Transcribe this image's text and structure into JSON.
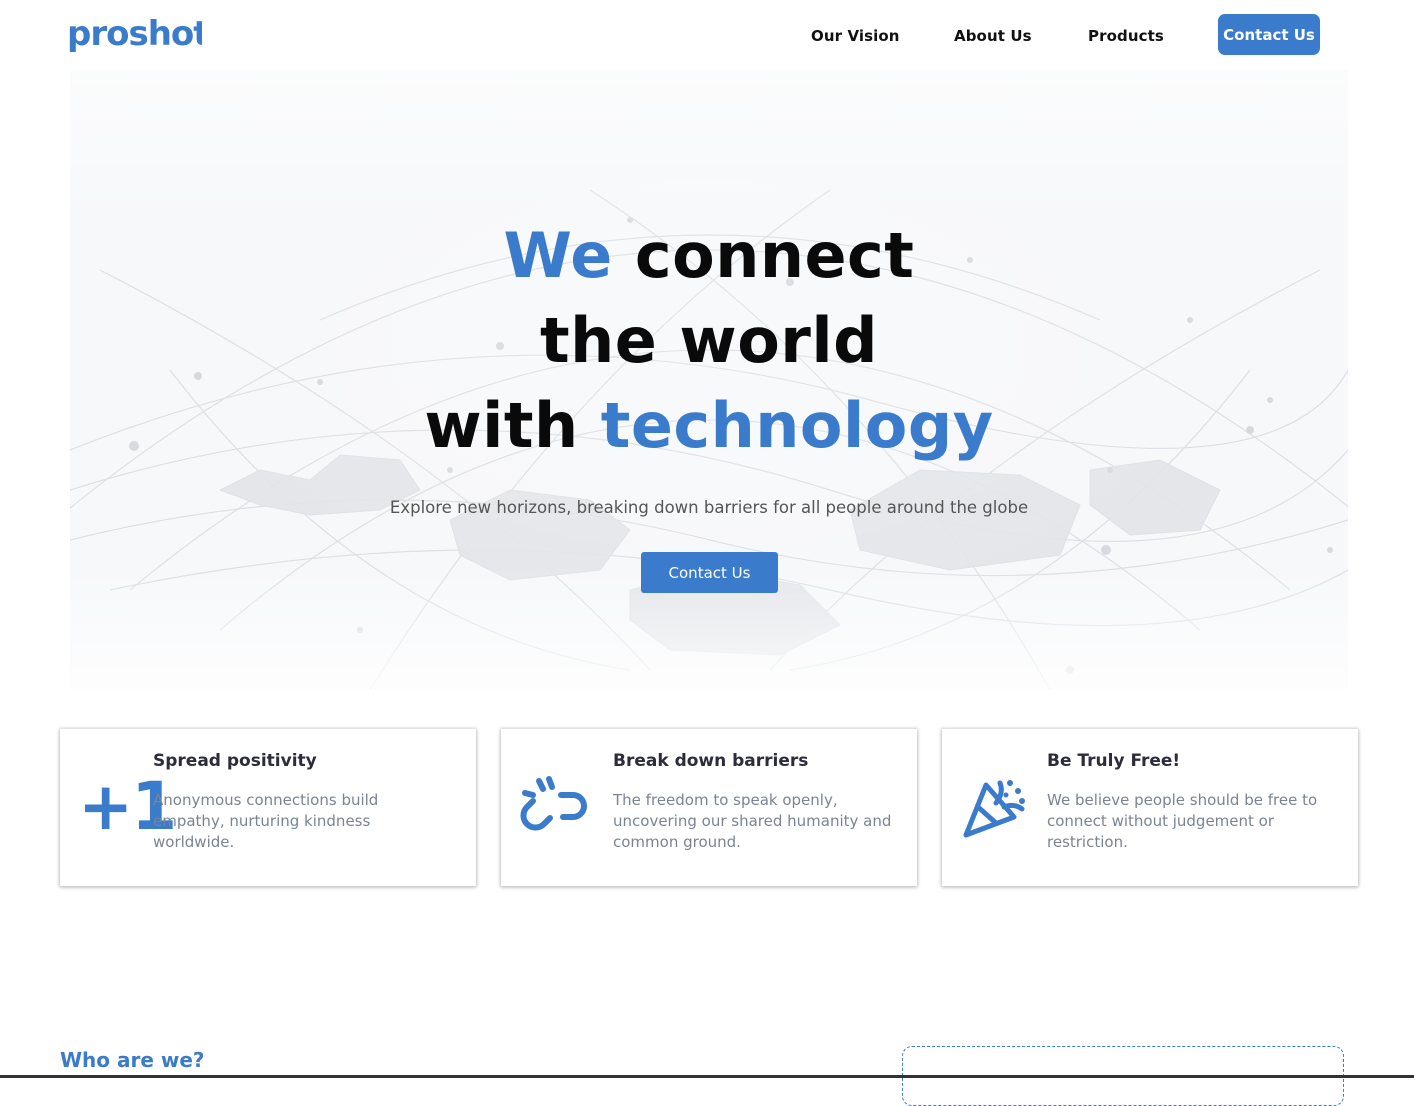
{
  "header": {
    "logo_text": "proshot",
    "nav": [
      {
        "label": "Our Vision"
      },
      {
        "label": "About Us"
      },
      {
        "label": "Products"
      }
    ],
    "cta_label": "Contact Us"
  },
  "hero": {
    "line1_accent": "We",
    "line1_rest": " connect",
    "line2": "the world",
    "line3_plain": "with ",
    "line3_accent": "technology",
    "subtitle": "Explore new horizons, breaking down barriers for all people around the globe",
    "cta_label": "Contact Us"
  },
  "features": [
    {
      "icon": "plus-one-icon",
      "icon_text": "+1",
      "title": "Spread positivity",
      "text": "Anonymous connections build empathy, nurturing kindness worldwide."
    },
    {
      "icon": "broken-link-icon",
      "title": "Break down barriers",
      "text": "The freedom to speak openly, uncovering our shared humanity and common ground."
    },
    {
      "icon": "party-popper-icon",
      "title": "Be Truly Free!",
      "text": "We believe people should be free to connect without judgement or restriction."
    }
  ],
  "about": {
    "heading": "Who are we?"
  },
  "colors": {
    "accent": "#3a7bcb",
    "text": "#0a0a0a",
    "muted": "#7a8493"
  }
}
